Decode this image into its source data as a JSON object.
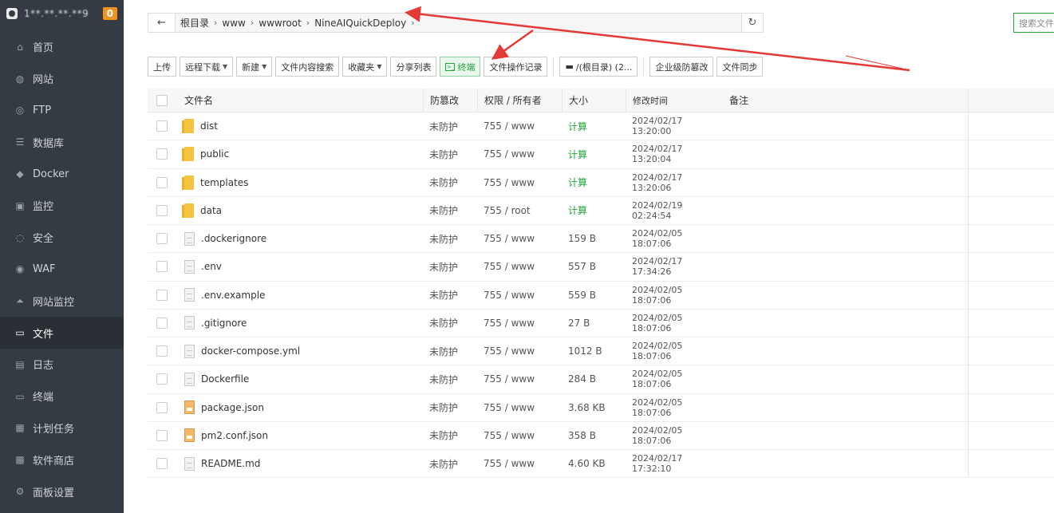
{
  "sidebar": {
    "ip": "1**.**.**.**9",
    "badge": "0",
    "items": [
      {
        "label": "首页",
        "icon": "home-icon",
        "glyph": "⌂"
      },
      {
        "label": "网站",
        "icon": "globe-icon",
        "glyph": "◍"
      },
      {
        "label": "FTP",
        "icon": "ftp-icon",
        "glyph": "◎"
      },
      {
        "label": "数据库",
        "icon": "database-icon",
        "glyph": "☰"
      },
      {
        "label": "Docker",
        "icon": "docker-icon",
        "glyph": "◆"
      },
      {
        "label": "监控",
        "icon": "monitor-icon",
        "glyph": "▣"
      },
      {
        "label": "安全",
        "icon": "shield-icon",
        "glyph": "◌"
      },
      {
        "label": "WAF",
        "icon": "waf-icon",
        "glyph": "◉"
      },
      {
        "label": "网站监控",
        "icon": "chart-icon",
        "glyph": "⏶"
      },
      {
        "label": "文件",
        "icon": "folder-icon",
        "glyph": "▭"
      },
      {
        "label": "日志",
        "icon": "log-icon",
        "glyph": "▤"
      },
      {
        "label": "终端",
        "icon": "terminal-icon",
        "glyph": "▭"
      },
      {
        "label": "计划任务",
        "icon": "calendar-icon",
        "glyph": "▦"
      },
      {
        "label": "软件商店",
        "icon": "grid-icon",
        "glyph": "▩"
      },
      {
        "label": "面板设置",
        "icon": "gear-icon",
        "glyph": "⚙"
      }
    ],
    "active_index": 9
  },
  "path": {
    "back_glyph": "←",
    "crumbs": [
      "根目录",
      "www",
      "wwwroot",
      "NineAIQuickDeploy"
    ],
    "sep": "›",
    "refresh_glyph": "↻"
  },
  "search": {
    "placeholder": "搜索文件"
  },
  "toolbar": {
    "upload": "上传",
    "remote_download": "远程下载",
    "new": "新建",
    "content_search": "文件内容搜索",
    "favorites": "收藏夹",
    "share_list": "分享列表",
    "terminal": "终端",
    "op_log": "文件操作记录",
    "disk": "/(根目录) (2...",
    "tamper": "企业级防篡改",
    "sync": "文件同步"
  },
  "table": {
    "headers": {
      "name": "文件名",
      "protect": "防篡改",
      "perm": "权限 / 所有者",
      "size": "大小",
      "time": "修改时间",
      "note": "备注"
    },
    "rows": [
      {
        "type": "folder",
        "name": "dist",
        "protect": "未防护",
        "perm": "755 / www",
        "size": "计算",
        "time": "2024/02/17 13:20:00"
      },
      {
        "type": "folder",
        "name": "public",
        "protect": "未防护",
        "perm": "755 / www",
        "size": "计算",
        "time": "2024/02/17 13:20:04"
      },
      {
        "type": "folder",
        "name": "templates",
        "protect": "未防护",
        "perm": "755 / www",
        "size": "计算",
        "time": "2024/02/17 13:20:06"
      },
      {
        "type": "folder",
        "name": "data",
        "protect": "未防护",
        "perm": "755 / root",
        "size": "计算",
        "time": "2024/02/19 02:24:54"
      },
      {
        "type": "file",
        "name": ".dockerignore",
        "protect": "未防护",
        "perm": "755 / www",
        "size": "159 B",
        "time": "2024/02/05 18:07:06"
      },
      {
        "type": "file",
        "name": ".env",
        "protect": "未防护",
        "perm": "755 / www",
        "size": "557 B",
        "time": "2024/02/17 17:34:26"
      },
      {
        "type": "file",
        "name": ".env.example",
        "protect": "未防护",
        "perm": "755 / www",
        "size": "559 B",
        "time": "2024/02/05 18:07:06"
      },
      {
        "type": "file",
        "name": ".gitignore",
        "protect": "未防护",
        "perm": "755 / www",
        "size": "27 B",
        "time": "2024/02/05 18:07:06"
      },
      {
        "type": "file",
        "name": "docker-compose.yml",
        "protect": "未防护",
        "perm": "755 / www",
        "size": "1012 B",
        "time": "2024/02/05 18:07:06"
      },
      {
        "type": "file",
        "name": "Dockerfile",
        "protect": "未防护",
        "perm": "755 / www",
        "size": "284 B",
        "time": "2024/02/05 18:07:06"
      },
      {
        "type": "json",
        "name": "package.json",
        "protect": "未防护",
        "perm": "755 / www",
        "size": "3.68 KB",
        "time": "2024/02/05 18:07:06"
      },
      {
        "type": "json",
        "name": "pm2.conf.json",
        "protect": "未防护",
        "perm": "755 / www",
        "size": "358 B",
        "time": "2024/02/05 18:07:06"
      },
      {
        "type": "file",
        "name": "README.md",
        "protect": "未防护",
        "perm": "755 / www",
        "size": "4.60 KB",
        "time": "2024/02/17 17:32:10"
      }
    ]
  },
  "colors": {
    "accent": "#20a53a",
    "sidebar": "#353b43",
    "annotation": "#e53935"
  }
}
